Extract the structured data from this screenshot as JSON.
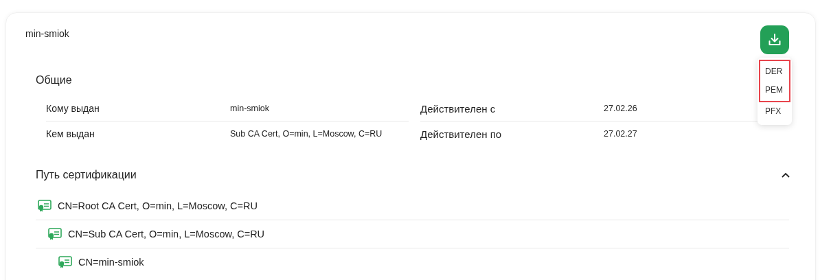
{
  "certificate": {
    "title": "min-smiok"
  },
  "download_menu": {
    "open": true,
    "items": [
      {
        "label": "DER",
        "highlighted": true
      },
      {
        "label": "PEM",
        "highlighted": true
      },
      {
        "label": "PFX",
        "highlighted": false
      }
    ]
  },
  "general": {
    "title": "Общие",
    "fields": [
      {
        "label": "Кому выдан",
        "value": "min-smiok"
      },
      {
        "label": "Действителен с",
        "value": "27.02.26"
      },
      {
        "label": "Кем выдан",
        "value": "Sub CA Cert, O=min, L=Moscow, C=RU"
      },
      {
        "label": "Действителен по",
        "value": "27.02.27"
      }
    ]
  },
  "certification_path": {
    "title": "Путь сертификации",
    "expanded": true,
    "tree": [
      {
        "name": "CN=Root CA Cert, O=min, L=Moscow, C=RU",
        "children": [
          {
            "name": "CN=Sub CA Cert, O=min, L=Moscow, C=RU",
            "children": [
              {
                "name": "CN=min-smiok"
              }
            ]
          }
        ]
      }
    ]
  }
}
